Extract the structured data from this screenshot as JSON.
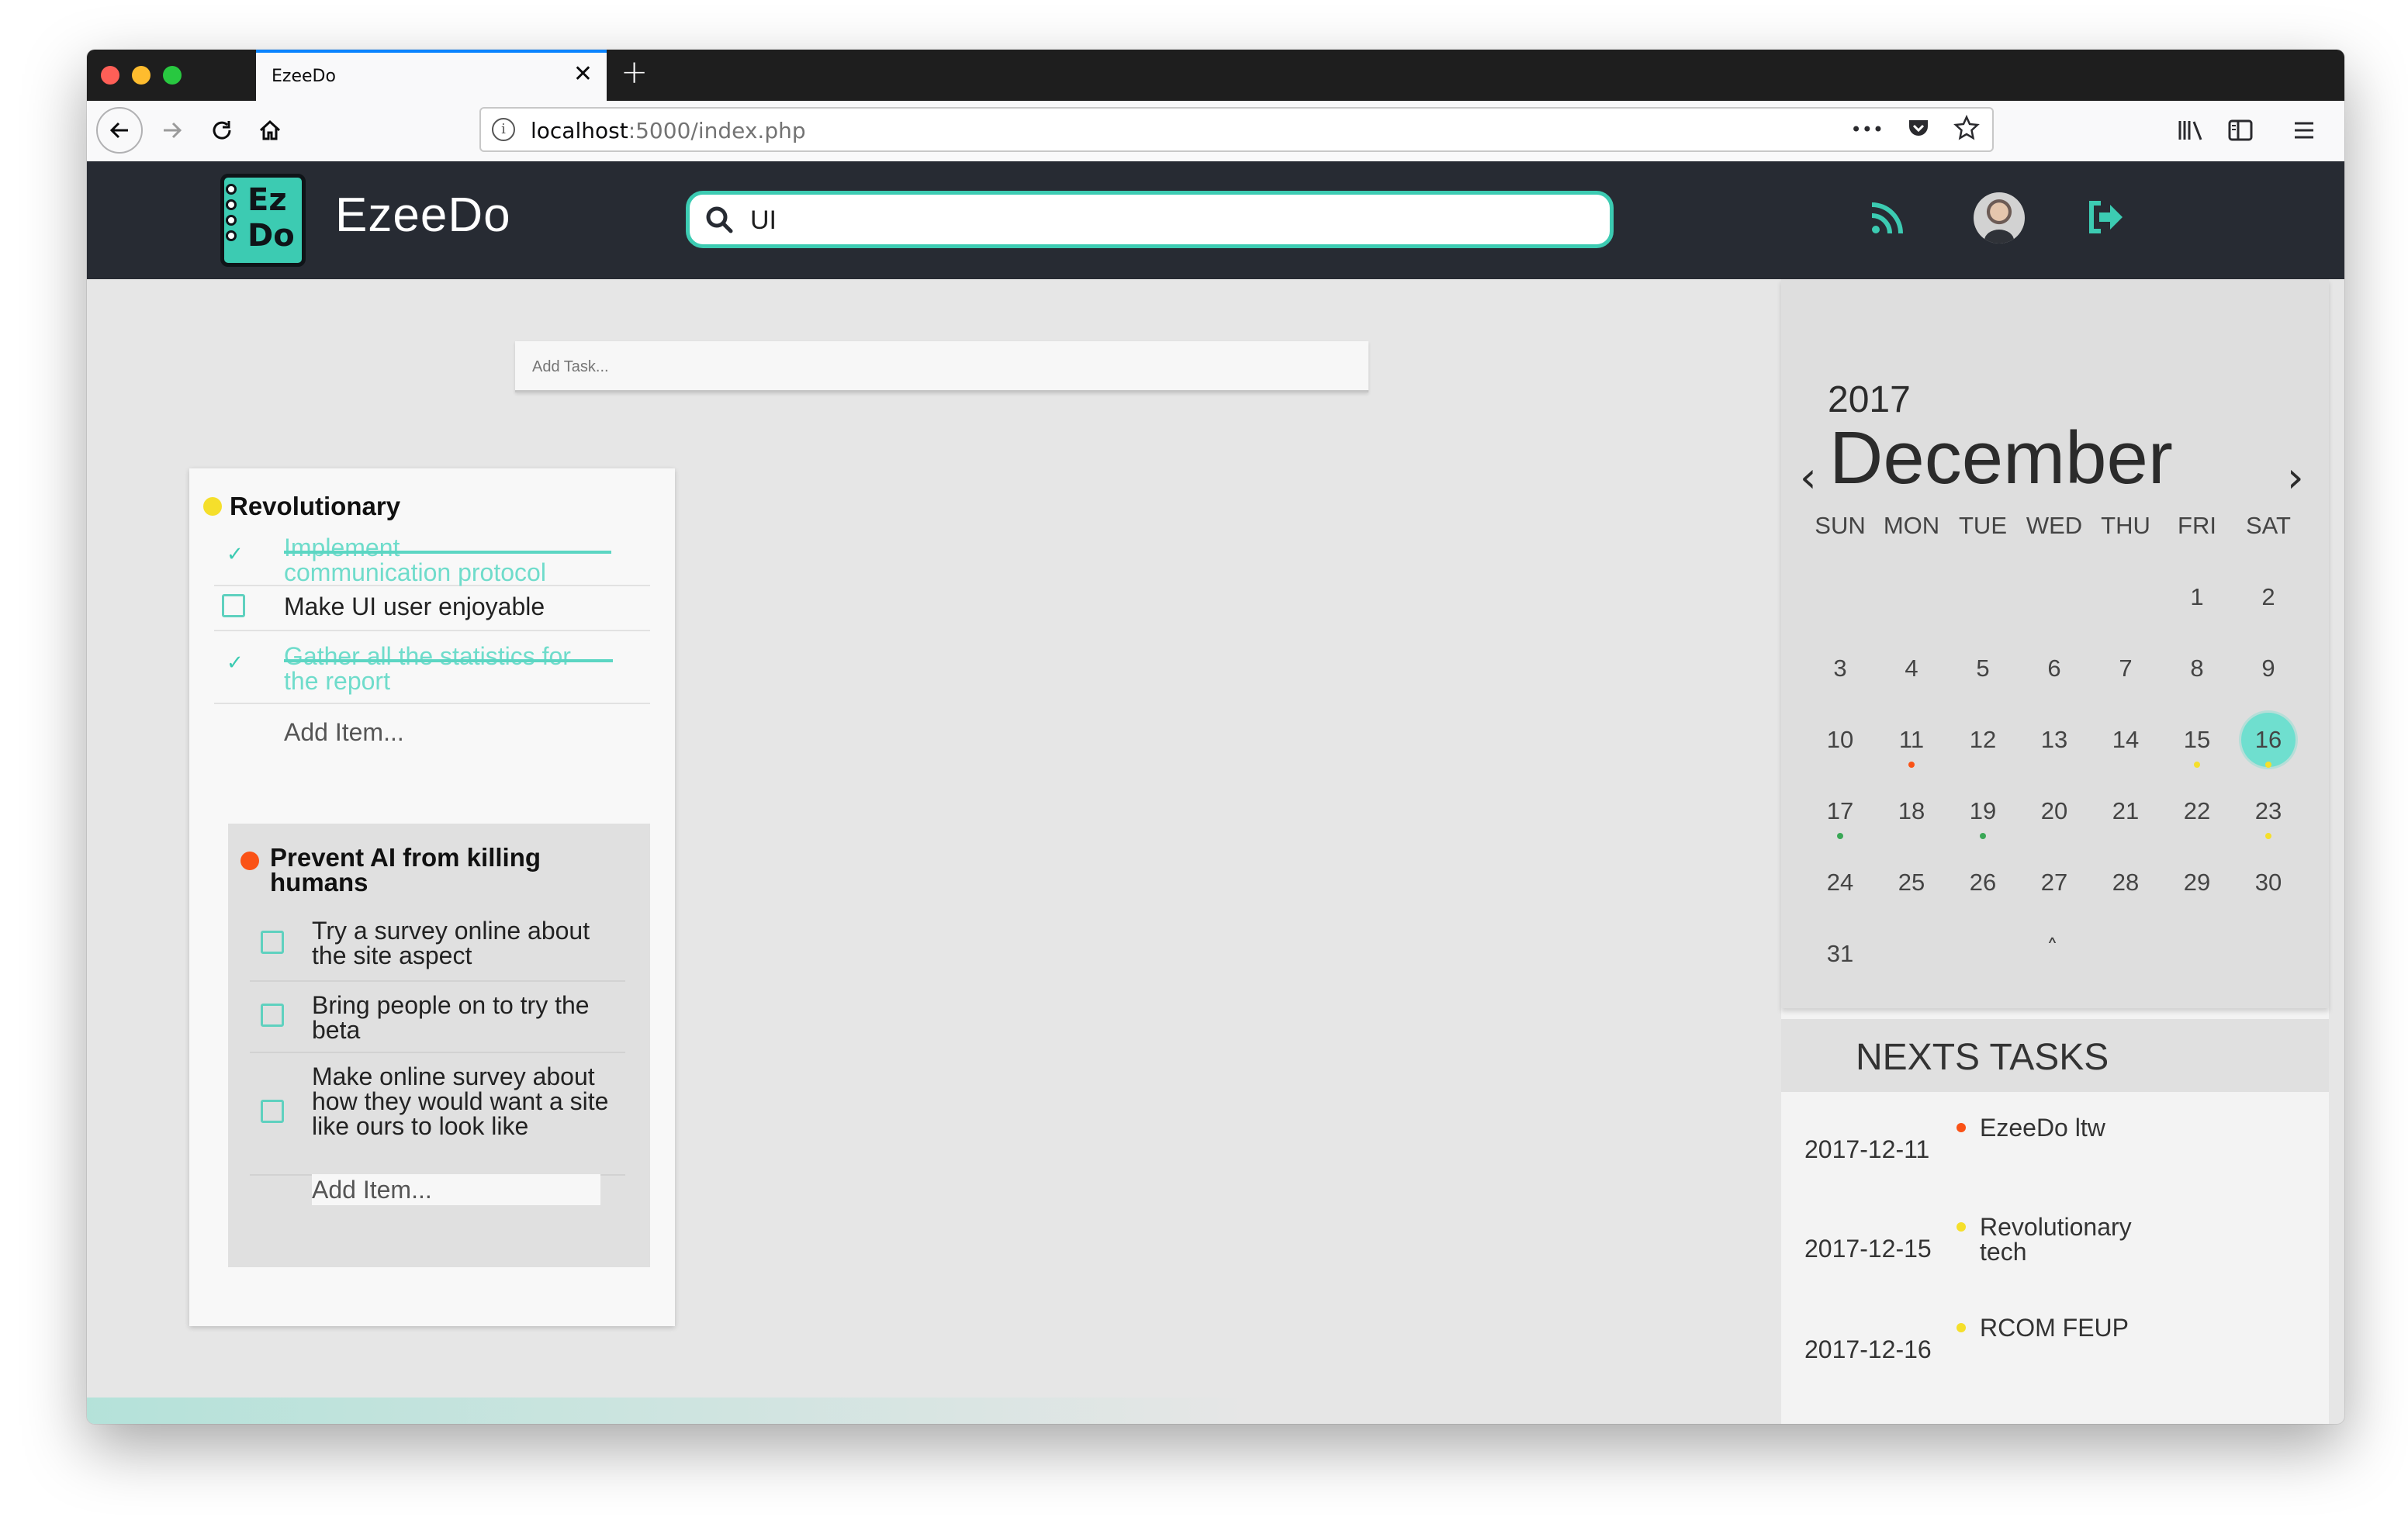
{
  "browser": {
    "tab_title": "EzeeDo",
    "tab_close": "✕",
    "new_tab": "+",
    "url_host": "localhost",
    "url_path": ":5000/index.php",
    "url_menu": "•••",
    "icons": [
      "back-icon",
      "forward-icon",
      "reload-icon",
      "home-icon",
      "page-info-icon",
      "page-actions-icon",
      "pocket-icon",
      "bookmark-star-icon",
      "library-icon",
      "sidebar-icon",
      "hamburger-menu-icon"
    ]
  },
  "app": {
    "logo_text_top": "Ez",
    "logo_text_bottom": "Do",
    "brand": "EzeeDo",
    "search_value": "UI",
    "add_task_placeholder": "Add Task...",
    "colors": {
      "header_bg": "#272b33",
      "accent": "#3ccbb2",
      "dot_yellow": "#f5df2b",
      "dot_red": "#fa5216",
      "dot_green": "#3aa756"
    }
  },
  "list": {
    "title": "Revolutionary",
    "dot_color": "#f5df2b",
    "items": [
      {
        "text_line1": "Implement",
        "text_line2": "communication protocol",
        "done": true
      },
      {
        "text": "Make UI user enjoyable",
        "done": false
      },
      {
        "text_line1": "Gather all the statistics for",
        "text_line2": "the report",
        "done": true
      }
    ],
    "add_item": "Add Item...",
    "check_glyph": "✓"
  },
  "sublist": {
    "title": "Prevent AI from killing humans",
    "dot_color": "#fa5216",
    "items": [
      {
        "text": "Try a survey online about the site aspect"
      },
      {
        "text": "Bring people on to try the beta"
      },
      {
        "text": "Make online survey about how they would want a site like ours to look like"
      }
    ],
    "add_item": "Add Item..."
  },
  "calendar": {
    "year": "2017",
    "month": "December",
    "prev": "‹",
    "next": "›",
    "weekdays": [
      "SUN",
      "MON",
      "TUE",
      "WED",
      "THU",
      "FRI",
      "SAT"
    ],
    "days": [
      "1",
      "2",
      "3",
      "4",
      "5",
      "6",
      "7",
      "8",
      "9",
      "10",
      "11",
      "12",
      "13",
      "14",
      "15",
      "16",
      "17",
      "18",
      "19",
      "20",
      "21",
      "22",
      "23",
      "24",
      "25",
      "26",
      "27",
      "28",
      "29",
      "30",
      "31"
    ],
    "first_weekday_index": 5,
    "today": "16",
    "events": [
      {
        "day": "11",
        "color": "#fa5216"
      },
      {
        "day": "15",
        "color": "#f5df2b"
      },
      {
        "day": "16",
        "color": "#f5df2b"
      },
      {
        "day": "17",
        "color": "#3aa756"
      },
      {
        "day": "19",
        "color": "#3aa756"
      },
      {
        "day": "23",
        "color": "#f5df2b"
      }
    ],
    "collapse": "˄"
  },
  "next_tasks": {
    "title": "NEXTS TASKS",
    "items": [
      {
        "date": "2017-12-11",
        "name": "EzeeDo ltw",
        "color": "#fa5216"
      },
      {
        "date": "2017-12-15",
        "name": "Revolutionary tech",
        "color": "#f5df2b"
      },
      {
        "date": "2017-12-16",
        "name": "RCOM FEUP",
        "color": "#f5df2b"
      }
    ]
  }
}
